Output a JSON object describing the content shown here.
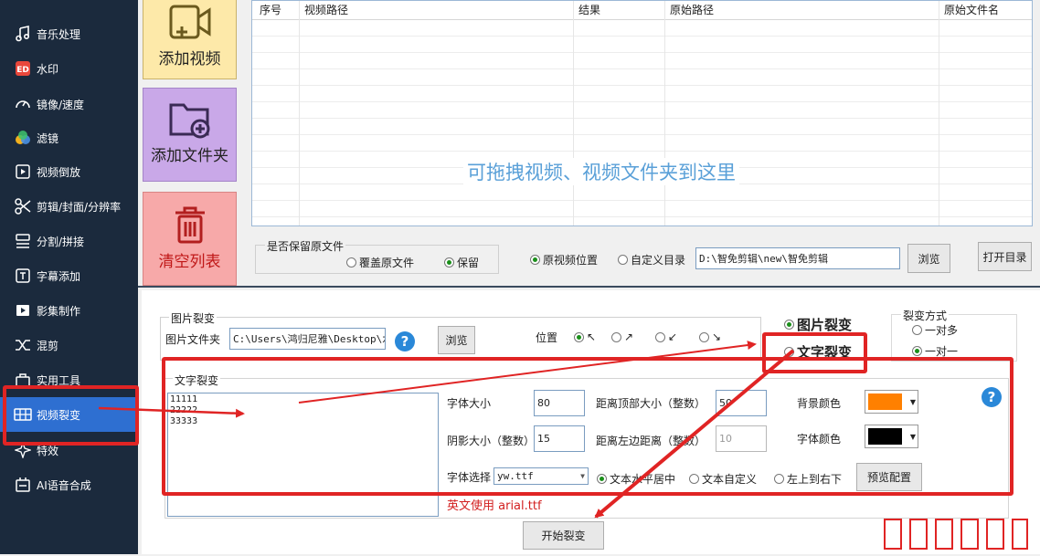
{
  "sidebar": {
    "items": [
      {
        "label": "音乐处理",
        "icon": "music-icon"
      },
      {
        "label": "水印",
        "icon": "watermark-icon"
      },
      {
        "label": "镜像/速度",
        "icon": "speed-icon"
      },
      {
        "label": "滤镜",
        "icon": "filter-icon"
      },
      {
        "label": "视频倒放",
        "icon": "reverse-icon"
      },
      {
        "label": "剪辑/封面/分辨率",
        "icon": "scissors-icon"
      },
      {
        "label": "分割/拼接",
        "icon": "split-icon"
      },
      {
        "label": "字幕添加",
        "icon": "subtitle-icon"
      },
      {
        "label": "影集制作",
        "icon": "album-icon"
      },
      {
        "label": "混剪",
        "icon": "shuffle-icon"
      },
      {
        "label": "实用工具",
        "icon": "toolbox-icon"
      },
      {
        "label": "视频裂变",
        "icon": "fission-icon"
      },
      {
        "label": "特效",
        "icon": "sparkle-icon"
      },
      {
        "label": "AI语音合成",
        "icon": "voice-icon"
      }
    ]
  },
  "buttons": {
    "add_video": "添加视频",
    "add_folder": "添加文件夹",
    "clear_list": "清空列表",
    "browse": "浏览",
    "open_dir": "打开目录",
    "browse2": "浏览",
    "preview_config": "预览配置",
    "start": "开始裂变"
  },
  "table": {
    "columns": [
      "序号",
      "视频路径",
      "结果",
      "原始路径",
      "原始文件名"
    ],
    "drop_hint": "可拖拽视频、视频文件夹到这里"
  },
  "keep_original": {
    "title": "是否保留原文件",
    "overwrite": "覆盖原文件",
    "keep": "保留"
  },
  "output": {
    "original_location": "原视频位置",
    "custom_dir": "自定义目录",
    "path": "D:\\智免剪辑\\new\\智免剪辑"
  },
  "image_fission": {
    "group_title": "图片裂变",
    "folder_label": "图片文件夹",
    "folder_path": "C:\\Users\\鸿归尼雅\\Desktop\\水",
    "position_label": "位置",
    "positions": [
      "↖",
      "↗",
      "↙",
      "↘"
    ]
  },
  "mode": {
    "image": "图片裂变",
    "text": "文字裂变"
  },
  "fission_method": {
    "title": "裂变方式",
    "one_to_many": "一对多",
    "one_to_one": "一对一"
  },
  "text_fission": {
    "group_title": "文字裂变",
    "lines": "11111\n22222\n33333",
    "font_size_label": "字体大小",
    "font_size": "80",
    "top_distance_label": "距离顶部大小（整数）",
    "top_distance": "50",
    "bg_color_label": "背景颜色",
    "shadow_label": "阴影大小（整数）",
    "shadow": "15",
    "left_distance_label": "距离左边距离（整数）",
    "left_distance": "10",
    "font_color_label": "字体颜色",
    "font_select_label": "字体选择",
    "font_file": "yw.ttf",
    "align_center": "文本水平居中",
    "align_custom": "文本自定义",
    "align_scroll": "左上到右下",
    "english_note": "英文使用 arial.ttf"
  },
  "colors": {
    "bg_color": "#ff8000",
    "font_color": "#000000",
    "accent": "#2e6fd1",
    "annotation": "#e02424"
  }
}
